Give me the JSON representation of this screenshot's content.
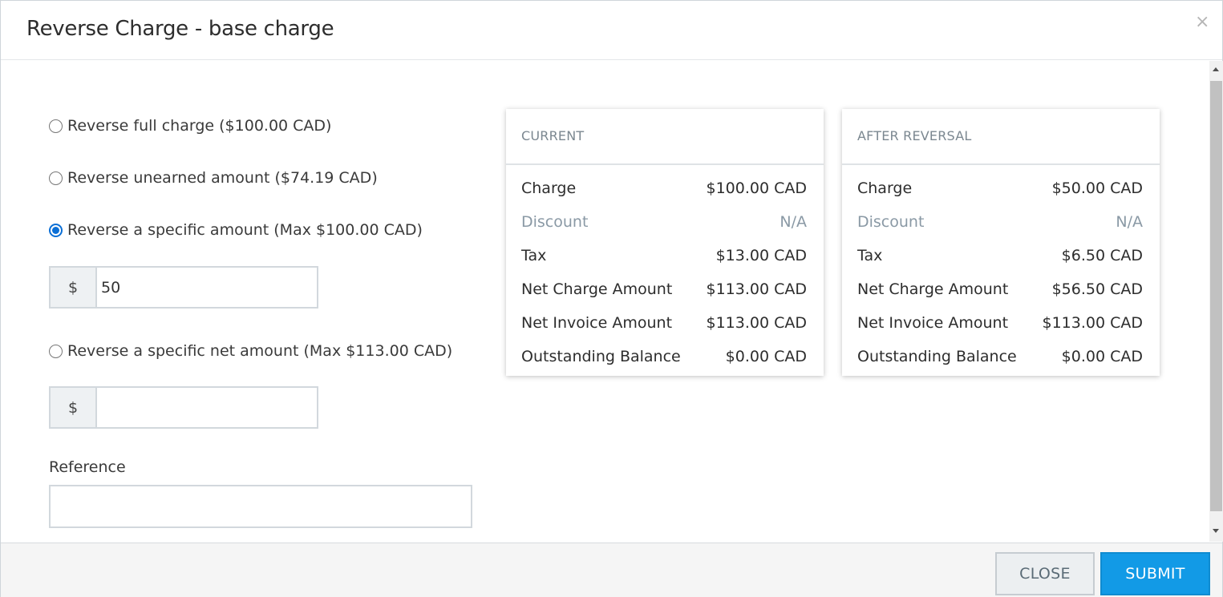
{
  "dialog": {
    "title": "Reverse Charge - base charge",
    "close_glyph": "×"
  },
  "options": [
    {
      "label": "Reverse full charge ($100.00 CAD)",
      "checked": false
    },
    {
      "label": "Reverse unearned amount ($74.19 CAD)",
      "checked": false
    },
    {
      "label": "Reverse a specific amount  (Max $100.00 CAD)",
      "checked": true
    },
    {
      "label": "Reverse a specific net amount  (Max $113.00 CAD)",
      "checked": false
    }
  ],
  "amount_field": {
    "currency_symbol": "$",
    "value": "50"
  },
  "net_amount_field": {
    "currency_symbol": "$",
    "value": ""
  },
  "reference": {
    "label": "Reference",
    "value": ""
  },
  "current": {
    "heading": "CURRENT",
    "rows": [
      {
        "label": "Charge",
        "value": "$100.00 CAD"
      },
      {
        "label": "Discount",
        "value": "N/A"
      },
      {
        "label": "Tax",
        "value": "$13.00 CAD"
      },
      {
        "label": "Net Charge Amount",
        "value": "$113.00 CAD"
      },
      {
        "label": "Net Invoice Amount",
        "value": "$113.00 CAD"
      },
      {
        "label": "Outstanding Balance",
        "value": "$0.00 CAD"
      }
    ]
  },
  "after": {
    "heading": "AFTER REVERSAL",
    "rows": [
      {
        "label": "Charge",
        "value": "$50.00 CAD"
      },
      {
        "label": "Discount",
        "value": "N/A"
      },
      {
        "label": "Tax",
        "value": "$6.50 CAD"
      },
      {
        "label": "Net Charge Amount",
        "value": "$56.50 CAD"
      },
      {
        "label": "Net Invoice Amount",
        "value": "$113.00 CAD"
      },
      {
        "label": "Outstanding Balance",
        "value": "$0.00 CAD"
      }
    ]
  },
  "footer": {
    "close_label": "CLOSE",
    "submit_label": "SUBMIT"
  },
  "colors": {
    "accent": "#129ae6",
    "radio_checked": "#0b6fd6",
    "muted_text": "#8a99a5"
  }
}
